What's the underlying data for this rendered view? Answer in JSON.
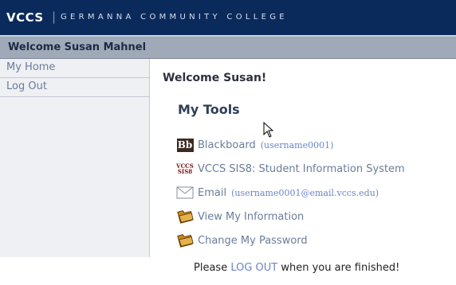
{
  "header": {
    "brand": "VCCS",
    "separator": "|",
    "college": "GERMANNA COMMUNITY COLLEGE"
  },
  "welcome_bar": {
    "text": "Welcome Susan Mahnel"
  },
  "sidebar": {
    "items": [
      {
        "label": "My Home"
      },
      {
        "label": "Log Out"
      }
    ]
  },
  "main": {
    "greeting": "Welcome Susan!",
    "tools_title": "My Tools",
    "tools": [
      {
        "label": "Blackboard",
        "detail": "(username0001)",
        "icon": "blackboard-icon"
      },
      {
        "label": "VCCS SIS8: Student Information System",
        "detail": "",
        "icon": "sis-icon"
      },
      {
        "label": "Email",
        "detail": "(username0001@email.vccs.edu)",
        "icon": "envelope-icon"
      },
      {
        "label": "View My Information",
        "detail": "",
        "icon": "folder-icon"
      },
      {
        "label": "Change My Password",
        "detail": "",
        "icon": "folder-icon"
      }
    ],
    "footer": {
      "before": "Please ",
      "link": "LOG OUT",
      "after": " when you are finished!"
    }
  },
  "icons": {
    "blackboard_text": "Bb",
    "sis_line1": "VCCS",
    "sis_line2": "SIS8"
  },
  "colors": {
    "header_bg": "#0a2a5c",
    "welcome_bg": "#9fa9b7",
    "link": "#6a7d99",
    "sidebar_bg": "#eff0f4"
  }
}
